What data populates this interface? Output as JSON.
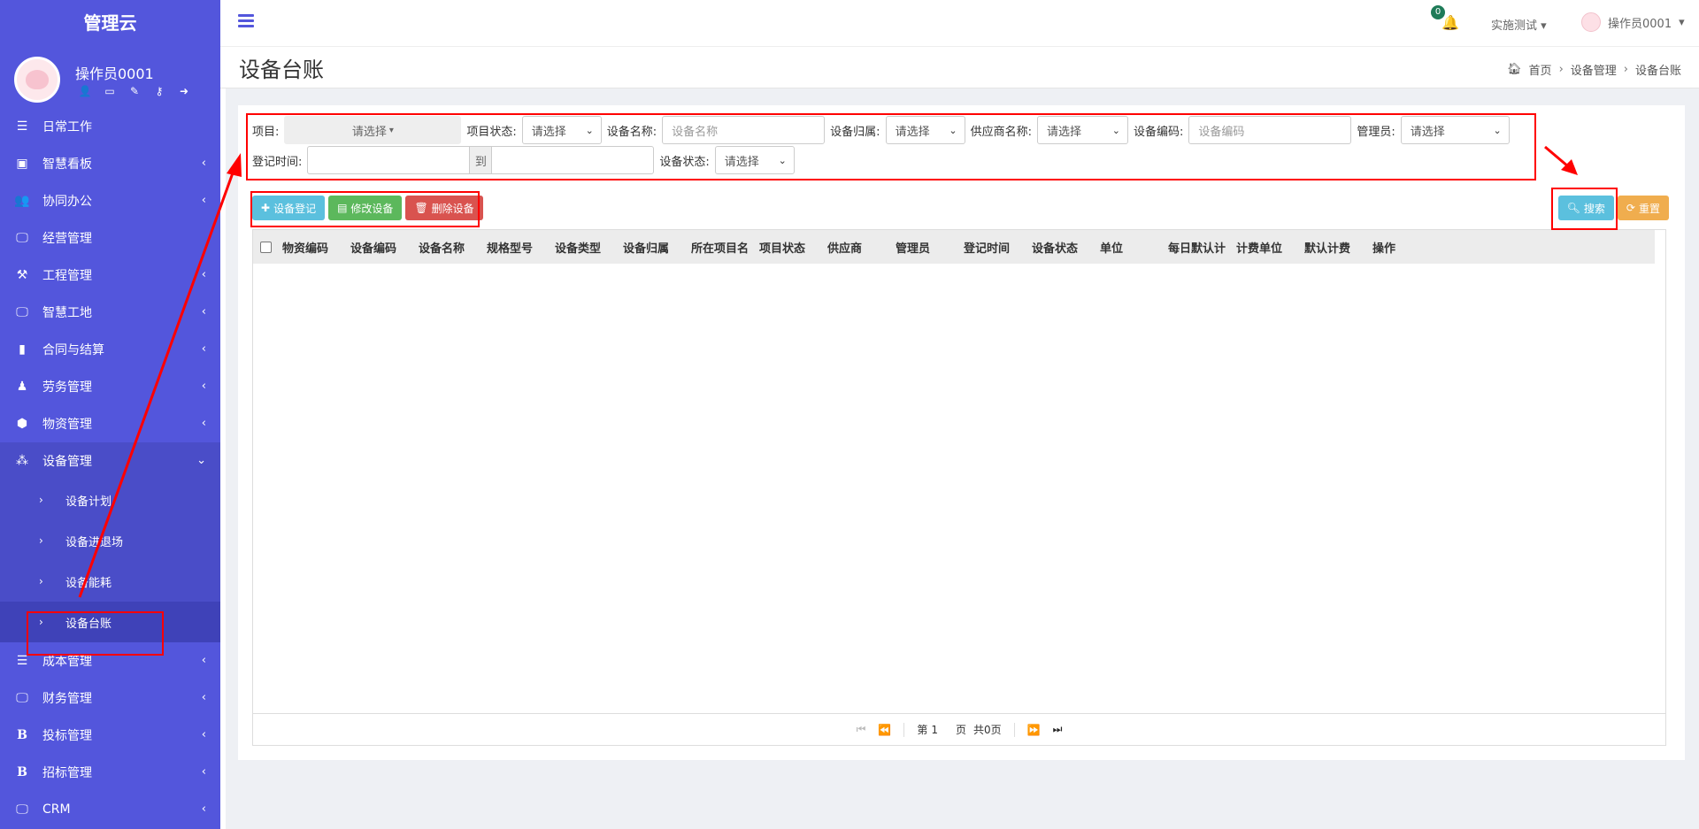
{
  "sidebar": {
    "brand": "管理云",
    "user_name": "操作员0001",
    "menu": [
      {
        "label": "日常工作",
        "icon": "list-icon",
        "chevron": false
      },
      {
        "label": "智慧看板",
        "icon": "dashboard-icon",
        "chevron": true
      },
      {
        "label": "协同办公",
        "icon": "users-icon",
        "chevron": true
      },
      {
        "label": "经营管理",
        "icon": "monitor-icon",
        "chevron": false
      },
      {
        "label": "工程管理",
        "icon": "gavel-icon",
        "chevron": true
      },
      {
        "label": "智慧工地",
        "icon": "monitor-icon",
        "chevron": true
      },
      {
        "label": "合同与结算",
        "icon": "file-icon",
        "chevron": true
      },
      {
        "label": "劳务管理",
        "icon": "worker-icon",
        "chevron": true
      },
      {
        "label": "物资管理",
        "icon": "cube-icon",
        "chevron": true
      },
      {
        "label": "设备管理",
        "icon": "cubes-icon",
        "chevron": true,
        "open": true
      }
    ],
    "submenu": [
      {
        "label": "设备计划"
      },
      {
        "label": "设备进退场"
      },
      {
        "label": "设备能耗"
      },
      {
        "label": "设备台账",
        "active": true
      }
    ],
    "menu_after": [
      {
        "label": "成本管理",
        "icon": "list-icon"
      },
      {
        "label": "财务管理",
        "icon": "monitor-icon"
      },
      {
        "label": "投标管理",
        "icon": "bold-b-icon"
      },
      {
        "label": "招标管理",
        "icon": "bold-b-icon"
      },
      {
        "label": "CRM",
        "icon": "monitor-icon"
      }
    ]
  },
  "topbar": {
    "notification_count": "0",
    "tenant": "实施测试",
    "user": "操作员0001"
  },
  "header": {
    "title": "设备台账",
    "breadcrumb": [
      "首页",
      "设备管理",
      "设备台账"
    ]
  },
  "filters": {
    "project_label": "项目:",
    "project_value": "请选择",
    "project_status_label": "项目状态:",
    "project_status_value": "请选择",
    "device_name_label": "设备名称:",
    "device_name_placeholder": "设备名称",
    "device_owner_label": "设备归属:",
    "device_owner_value": "请选择",
    "supplier_label": "供应商名称:",
    "supplier_value": "请选择",
    "device_code_label": "设备编码:",
    "device_code_placeholder": "设备编码",
    "manager_label": "管理员:",
    "manager_value": "请选择",
    "reg_time_label": "登记时间:",
    "reg_time_sep": "到",
    "device_status_label": "设备状态:",
    "device_status_value": "请选择"
  },
  "toolbar": {
    "register": "设备登记",
    "edit": "修改设备",
    "delete": "删除设备",
    "search": "搜索",
    "reset": "重置"
  },
  "table": {
    "columns": [
      "物资编码",
      "设备编码",
      "设备名称",
      "规格型号",
      "设备类型",
      "设备归属",
      "所在项目名",
      "项目状态",
      "供应商",
      "管理员",
      "登记时间",
      "设备状态",
      "单位",
      "每日默认计",
      "计费单位",
      "默认计费",
      "操作"
    ]
  },
  "pager": {
    "page_prefix": "第",
    "page_value": "1",
    "page_suffix": "页",
    "total": "共0页"
  },
  "colors": {
    "sidebar": "#5356dc",
    "annotation": "#ff0000"
  }
}
